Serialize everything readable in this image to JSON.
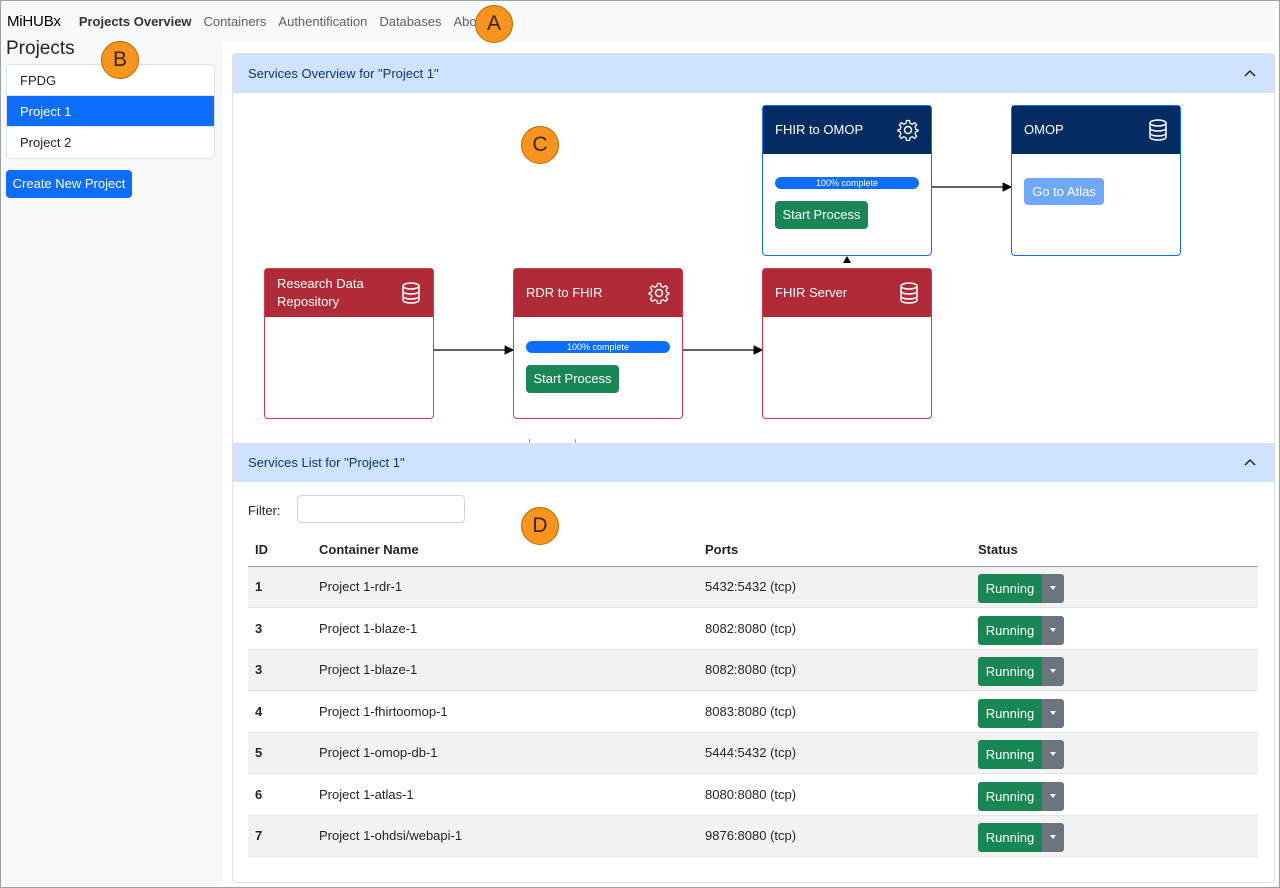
{
  "navbar": {
    "brand": "MiHUBx",
    "links": [
      "Projects Overview",
      "Containers",
      "Authentification",
      "Databases",
      "About"
    ]
  },
  "sidebar": {
    "title": "Projects",
    "projects": [
      "FPDG",
      "Project 1",
      "Project 2"
    ],
    "create_button": "Create New Project"
  },
  "services_overview": {
    "header": "Services Overview for \"Project 1\"",
    "nodes": {
      "research_data": "Research Data Repository",
      "rdr_to_fhir": "RDR to FHIR",
      "fhir_server": "FHIR Server",
      "fhir_to_omop": "FHIR to OMOP",
      "omop": "OMOP"
    },
    "progress_label": "100% complete",
    "progress_value": 1.0,
    "start_button": "Start Process",
    "atlas_button": "Go to Atlas"
  },
  "services_list": {
    "header": "Services List for \"Project 1\"",
    "filter_label": "Filter:",
    "columns": [
      "ID",
      "Container Name",
      "Ports",
      "Status"
    ],
    "rows": [
      {
        "id": "1",
        "name": "Project 1-rdr-1",
        "ports": "5432:5432 (tcp)",
        "status": "Running"
      },
      {
        "id": "3",
        "name": "Project 1-blaze-1",
        "ports": "8082:8080 (tcp)",
        "status": "Running"
      },
      {
        "id": "3",
        "name": "Project 1-blaze-1",
        "ports": "8082:8080 (tcp)",
        "status": "Running"
      },
      {
        "id": "4",
        "name": "Project 1-fhirtoomop-1",
        "ports": "8083:8080 (tcp)",
        "status": "Running"
      },
      {
        "id": "5",
        "name": "Project 1-omop-db-1",
        "ports": "5444:5432 (tcp)",
        "status": "Running"
      },
      {
        "id": "6",
        "name": "Project 1-atlas-1",
        "ports": "8080:8080 (tcp)",
        "status": "Running"
      },
      {
        "id": "7",
        "name": "Project 1-ohdsi/webapi-1",
        "ports": "9876:8080 (tcp)",
        "status": "Running"
      }
    ]
  },
  "markers": [
    "A",
    "B",
    "C",
    "D"
  ],
  "colors": {
    "primary": "#0d6efd",
    "success": "#198754",
    "danger_header": "#b02a37",
    "navy_header": "#052c65",
    "accordion": "#cfe2ff",
    "marker": "#f7941d"
  }
}
